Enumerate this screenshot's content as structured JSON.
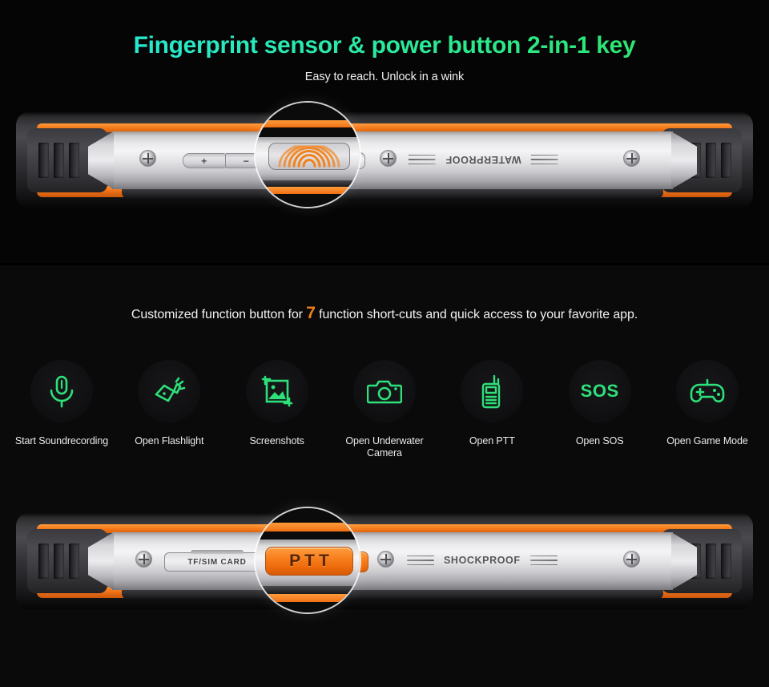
{
  "section_one": {
    "title": "Fingerprint sensor & power button 2-in-1 key",
    "subtitle": "Easy to reach. Unlock in a wink",
    "title_gradient_from": "#22E7E4",
    "title_gradient_to": "#2FE25A",
    "phone": {
      "volume_up_label": "+",
      "volume_down_label": "−",
      "engraving": "WATERPROOF",
      "magnifier_target": "fingerprint-sensor"
    }
  },
  "section_two": {
    "heading_before": "Customized function button for ",
    "heading_number": "7",
    "heading_after": " function short-cuts and quick access to your favorite app.",
    "accent_color": "#f07e18",
    "icon_color": "#2EE07A",
    "shortcuts": [
      {
        "icon": "microphone-icon",
        "label": "Start Soundrecording"
      },
      {
        "icon": "flashlight-icon",
        "label": "Open Flashlight"
      },
      {
        "icon": "screenshot-icon",
        "label": "Screenshots"
      },
      {
        "icon": "camera-icon",
        "label": "Open Underwater Camera"
      },
      {
        "icon": "walkie-talkie-icon",
        "label": "Open PTT"
      },
      {
        "icon": "sos-icon",
        "label": "Open SOS",
        "glyph": "SOS"
      },
      {
        "icon": "gamepad-icon",
        "label": "Open Game Mode"
      }
    ],
    "phone": {
      "card_tray_label": "TF/SIM CARD",
      "ptt_button_label": "PTT",
      "engraving": "SHOCKPROOF",
      "magnifier_target": "ptt-button"
    }
  }
}
